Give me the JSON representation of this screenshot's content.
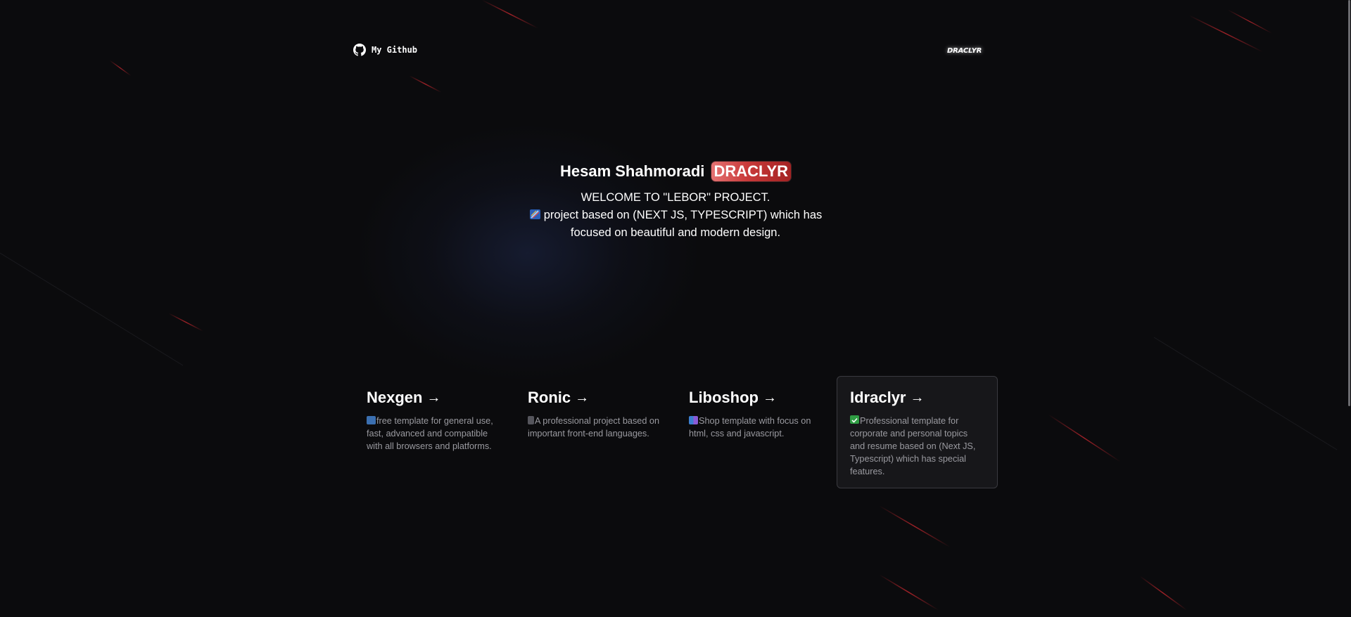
{
  "header": {
    "github_label": "My Github",
    "logo_text": "DRACLYR"
  },
  "hero": {
    "name": "Hesam Shahmoradi",
    "badge": "DRACLYR",
    "line1": "WELCOME TO \"LEBOR\" PROJECT.",
    "line2": "project based on (NEXT JS, TYPESCRIPT) which has",
    "line3": "focused on beautiful and modern design."
  },
  "cards": [
    {
      "title": "Nexgen",
      "emoji": "laptop-emoji",
      "desc": "free template for general use, fast, advanced and compatible with all browsers and platforms."
    },
    {
      "title": "Ronic",
      "emoji": "phone-emoji",
      "desc": "A professional project based on important front-end languages."
    },
    {
      "title": "Liboshop",
      "emoji": "shopping-bags-emoji",
      "desc": "Shop template with focus on html, css and javascript."
    },
    {
      "title": "Idraclyr",
      "emoji": "check-mark-emoji",
      "desc": "Professional template for corporate and personal topics and resume based on (Next JS, Typescript) which has special features."
    }
  ],
  "colors": {
    "background": "#0b0b0d",
    "badge_start": "#e57373",
    "badge_end": "#a42222",
    "streak": "#c0262d",
    "muted_text": "#9a9aa0"
  }
}
